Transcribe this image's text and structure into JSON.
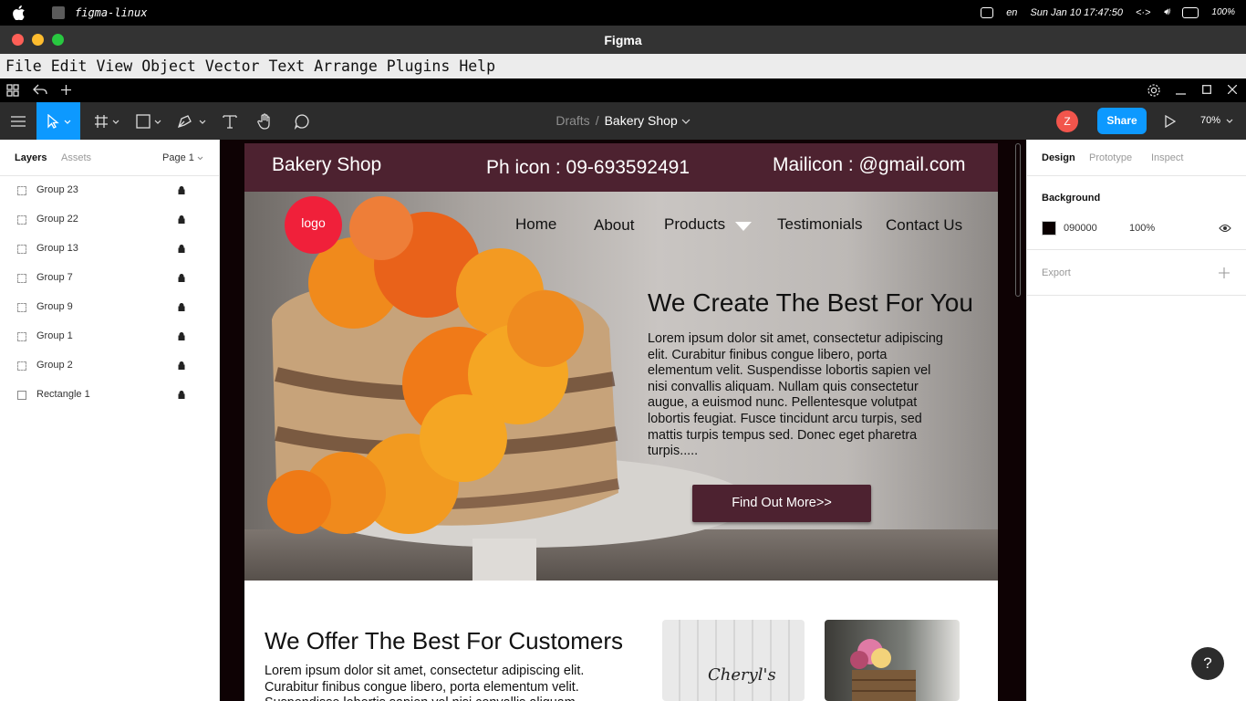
{
  "os_bar": {
    "app_name": "figma-linux",
    "lang": "en",
    "datetime": "Sun Jan 10  17:47:50",
    "battery": "100%"
  },
  "window": {
    "title": "Figma"
  },
  "menu": [
    "File",
    "Edit",
    "View",
    "Object",
    "Vector",
    "Text",
    "Arrange",
    "Plugins",
    "Help"
  ],
  "toolbar": {
    "breadcrumb_root": "Drafts",
    "breadcrumb_sep": "/",
    "file_name": "Bakery Shop",
    "avatar_initial": "Z",
    "share_label": "Share",
    "zoom": "70%"
  },
  "left_panel": {
    "tab_layers": "Layers",
    "tab_assets": "Assets",
    "page": "Page 1",
    "layers": [
      {
        "name": "Group 23",
        "type": "group",
        "locked": true
      },
      {
        "name": "Group 22",
        "type": "group",
        "locked": true
      },
      {
        "name": "Group 13",
        "type": "group",
        "locked": true
      },
      {
        "name": "Group 7",
        "type": "group",
        "locked": true
      },
      {
        "name": "Group 9",
        "type": "group",
        "locked": true
      },
      {
        "name": "Group 1",
        "type": "group",
        "locked": true
      },
      {
        "name": "Group 2",
        "type": "group",
        "locked": true
      },
      {
        "name": "Rectangle 1",
        "type": "rectangle",
        "locked": true
      }
    ]
  },
  "design": {
    "header": {
      "brand": "Bakery Shop",
      "phone": "Ph icon : 09-693592491",
      "mail": "Mailicon : @gmail.com"
    },
    "logo": "logo",
    "nav": [
      "Home",
      "About",
      "Products",
      "Testimonials",
      "Contact Us"
    ],
    "hero": {
      "title": "We Create The Best For You",
      "text": "Lorem ipsum dolor sit amet, consectetur adipiscing elit. Curabitur finibus congue libero, porta elementum velit. Suspendisse lobortis sapien vel nisi convallis aliquam. Nullam quis consectetur augue, a euismod nunc. Pellentesque volutpat lobortis feugiat. Fusce tincidunt arcu turpis, sed mattis turpis tempus sed. Donec eget pharetra turpis.....",
      "cta": "Find Out More>>"
    },
    "section2": {
      "title": "We Offer The Best For Customers",
      "text": "Lorem ipsum dolor sit amet, consectetur adipiscing elit. Curabitur finibus congue libero, porta elementum velit. Suspendisse lobortis sapien vel nisi convallis aliquam.",
      "photo1_text": "Cheryl's"
    }
  },
  "right_panel": {
    "tab_design": "Design",
    "tab_prototype": "Prototype",
    "tab_inspect": "Inspect",
    "background_label": "Background",
    "bg_hex": "090000",
    "bg_opacity": "100%",
    "export_label": "Export"
  },
  "colors": {
    "accent_blue": "#0d99ff",
    "header_maroon": "#4d2230",
    "logo_red": "#f0203a",
    "avatar": "#f2554c"
  },
  "help": "?"
}
